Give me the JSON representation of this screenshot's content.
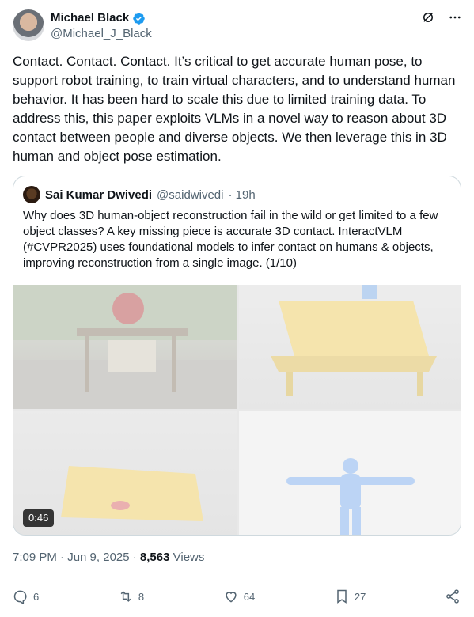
{
  "author": {
    "display_name": "Michael Black",
    "handle": "@Michael_J_Black",
    "avatar_icon": "profile-photo"
  },
  "header_icons": [
    "grok-icon",
    "more-icon"
  ],
  "tweet_text": "Contact. Contact. Contact. It’s critical to get accurate human pose, to support robot training, to train virtual characters, and to understand human behavior. It has been hard to scale this due to limited training data. To address this, this paper exploits VLMs in a novel way to reason about 3D contact between people and diverse objects. We then leverage this in 3D human and object pose estimation.",
  "quote": {
    "display_name": "Sai Kumar Dwivedi",
    "handle": "@saidwivedi",
    "time": "· 19h",
    "text": "Why does 3D human-object reconstruction fail in the wild or get limited to a few object classes? A key missing piece is accurate 3D contact. InteractVLM (#CVPR2025) uses foundational models to infer contact on humans & objects, improving reconstruction from a single image. (1/10)",
    "video_duration": "0:46"
  },
  "meta": {
    "time_date": "7:09 PM · Jun 9, 2025 · ",
    "views_count": "8,563",
    "views_label": " Views"
  },
  "actions": {
    "replies": "6",
    "reposts": "8",
    "likes": "64",
    "bookmarks": "27"
  },
  "colors": {
    "text": "#0f1419",
    "secondary": "#536471",
    "verified": "#1d9bf0",
    "border": "#cfd9de"
  }
}
